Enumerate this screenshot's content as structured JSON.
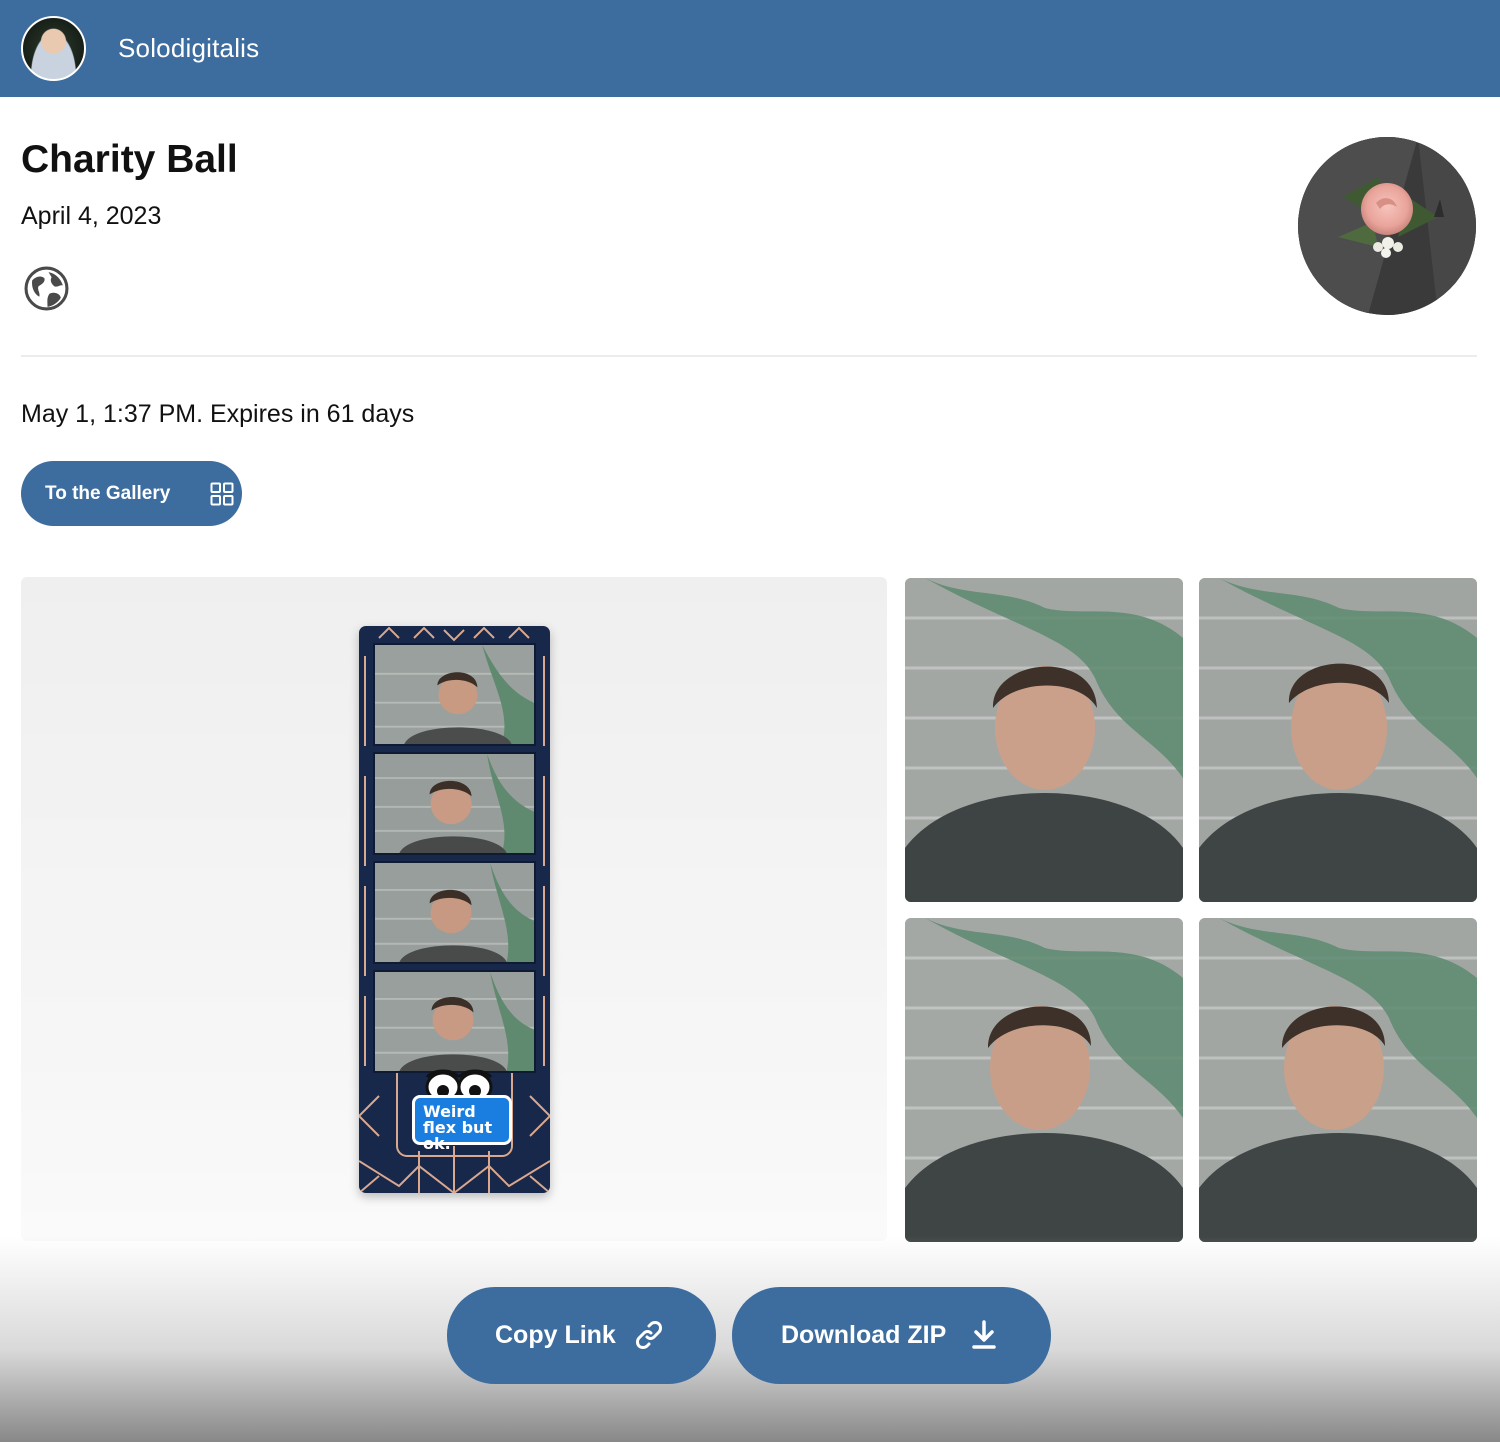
{
  "header": {
    "brand_name": "Solodigitalis",
    "avatar_icon": "user-avatar",
    "bar_color": "#3d6c9f"
  },
  "event": {
    "title": "Charity Ball",
    "date": "April 4, 2023",
    "visibility_icon": "globe-icon",
    "cover_image": "boutonniere-rose"
  },
  "session": {
    "info": "May 1, 1:37 PM. Expires in 61 days"
  },
  "gallery_button": {
    "label": "To the Gallery",
    "icon": "grid-icon"
  },
  "preview": {
    "type": "photo-strip",
    "strip_frames": 4,
    "sticker_text": "Weird flex but ok."
  },
  "thumbnails": [
    {
      "name": "photo-1"
    },
    {
      "name": "photo-2"
    },
    {
      "name": "photo-3"
    },
    {
      "name": "photo-4"
    }
  ],
  "actions": {
    "copy_link_label": "Copy Link",
    "copy_link_icon": "link-icon",
    "download_label": "Download ZIP",
    "download_icon": "download-icon"
  },
  "colors": {
    "accent": "#3d6c9f",
    "strip_background": "#17284a",
    "sticker_blue": "#1a7ee0"
  }
}
